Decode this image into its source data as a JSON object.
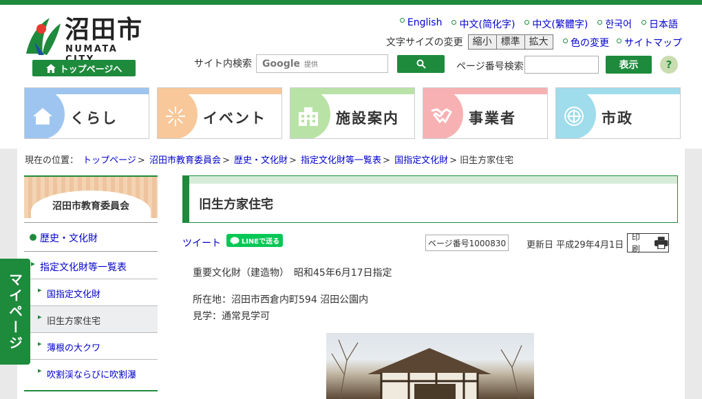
{
  "header": {
    "logo_kanji": "沼田市",
    "logo_en": "NUMATA CITY",
    "top_page_button": "トップページへ",
    "languages": [
      "English",
      "中文(简化字)",
      "中文(繁體字)",
      "한국어",
      "日本語"
    ],
    "font_size_label": "文字サイズの変更",
    "font_size_buttons": [
      "縮小",
      "標準",
      "拡大"
    ],
    "color_change": "色の変更",
    "sitemap": "サイトマップ",
    "site_search_label": "サイト内検索",
    "search_google": "Google",
    "search_provided": "提供",
    "page_number_search_label": "ページ番号検索",
    "show_button": "表示",
    "help": "?"
  },
  "global_nav": [
    {
      "label": "くらし",
      "color": "#9ec5f0",
      "icon": "house-icon"
    },
    {
      "label": "イベント",
      "color": "#f8c89a",
      "icon": "firework-icon"
    },
    {
      "label": "施設案内",
      "color": "#b9e3a6",
      "icon": "building-icon"
    },
    {
      "label": "事業者",
      "color": "#f7b1b3",
      "icon": "handshake-icon"
    },
    {
      "label": "市政",
      "color": "#9fdcec",
      "icon": "city-emblem-icon"
    }
  ],
  "breadcrumb": {
    "prefix": "現在の位置：",
    "items": [
      "トップページ",
      "沼田市教育委員会",
      "歴史・文化財",
      "指定文化財等一覧表",
      "国指定文化財"
    ],
    "current": "旧生方家住宅"
  },
  "sidebar": {
    "heading": "沼田市教育委員会",
    "level1": "歴史・文化財",
    "level2": "指定文化財等一覧表",
    "level3": [
      "国指定文化財",
      "旧生方家住宅",
      "薄根の大クワ",
      "吹割渓ならびに吹割瀑"
    ],
    "mypage": "マイページ"
  },
  "article": {
    "title": "旧生方家住宅",
    "tweet": "ツイート",
    "line": "LINEで送る",
    "page_number": "ページ番号1000830",
    "updated": "更新日 平成29年4月1日",
    "print": "印刷",
    "line1": "重要文化財（建造物）　昭和45年6月17日指定",
    "line2": "所在地：沼田市西倉内町594 沼田公園内",
    "line3": "見学：通常見学可"
  },
  "colors": {
    "brand_green": "#1e8a3c"
  }
}
